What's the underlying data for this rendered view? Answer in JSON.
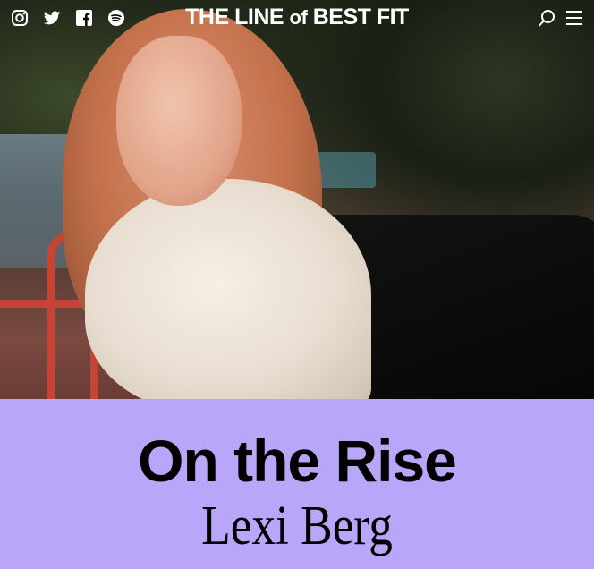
{
  "header": {
    "logo_main": "THE LINE ",
    "logo_of": "of",
    "logo_end": " BEST FIT",
    "social": [
      "instagram-icon",
      "twitter-icon",
      "facebook-icon",
      "spotify-icon"
    ],
    "actions": [
      "search-icon",
      "menu-icon"
    ]
  },
  "hero": {
    "image": "portrait-photo",
    "accent_colors": {
      "railing": "#e6a23a",
      "red_rail": "#c74434"
    }
  },
  "feature": {
    "kicker": "On the Rise",
    "artist": "Lexi Berg",
    "panel_color": "#b9a6f8"
  }
}
